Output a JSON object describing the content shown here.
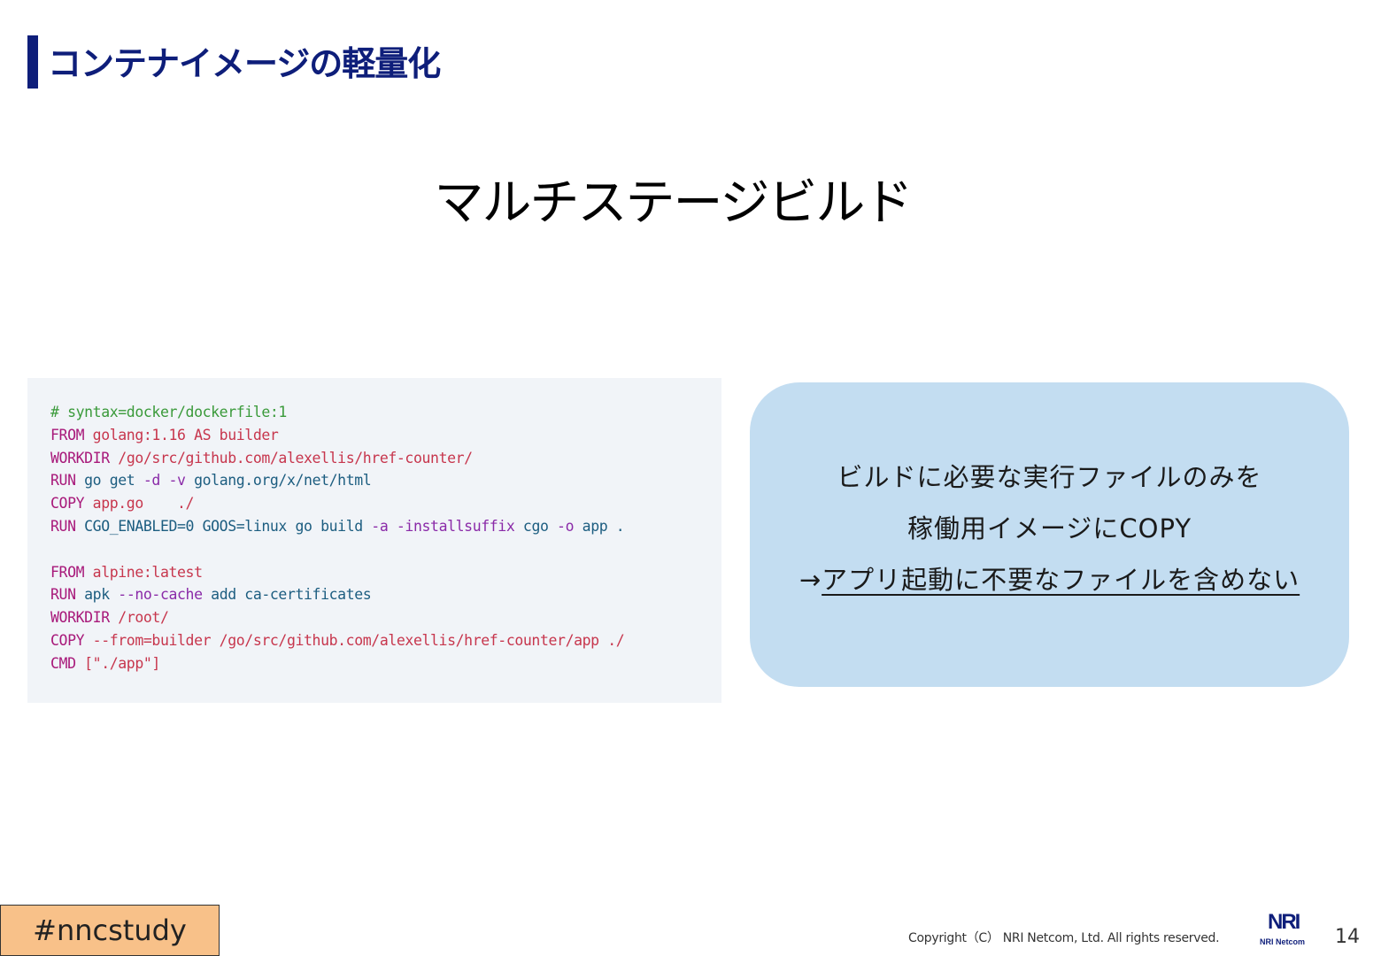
{
  "colors": {
    "title_navy": "#0e1e7a",
    "code_bg": "#f1f4f8",
    "callout_bg": "#c3ddf1",
    "hashtag_bg": "#f8c189",
    "code_comment": "#3a9a3a",
    "code_keyword": "#a8197a",
    "code_string": "#c7364d",
    "code_text": "#1c5d80",
    "code_flag": "#8a2aa8"
  },
  "header": {
    "title": "コンテナイメージの軽量化"
  },
  "main": {
    "subtitle": "マルチステージビルド",
    "code_lines": [
      [
        {
          "t": "# syntax=docker/dockerfile:1",
          "c": "comment"
        }
      ],
      [
        {
          "t": "FROM ",
          "c": "keyword"
        },
        {
          "t": "golang:1.16 AS builder",
          "c": "string"
        }
      ],
      [
        {
          "t": "WORKDIR ",
          "c": "keyword"
        },
        {
          "t": "/go/src/github.com/alexellis/href-counter/",
          "c": "string"
        }
      ],
      [
        {
          "t": "RUN ",
          "c": "keyword"
        },
        {
          "t": "go get ",
          "c": "text"
        },
        {
          "t": "-d -v ",
          "c": "flag"
        },
        {
          "t": "golang.org/x/net/html",
          "c": "text"
        }
      ],
      [
        {
          "t": "COPY ",
          "c": "keyword"
        },
        {
          "t": "app.go    ./",
          "c": "string"
        }
      ],
      [
        {
          "t": "RUN ",
          "c": "keyword"
        },
        {
          "t": "CGO_ENABLED=0 GOOS=linux go build ",
          "c": "text"
        },
        {
          "t": "-a -installsuffix ",
          "c": "flag"
        },
        {
          "t": "cgo ",
          "c": "text"
        },
        {
          "t": "-o ",
          "c": "flag"
        },
        {
          "t": "app .",
          "c": "text"
        }
      ],
      [
        {
          "t": "",
          "c": "text"
        }
      ],
      [
        {
          "t": "FROM ",
          "c": "keyword"
        },
        {
          "t": "alpine:latest",
          "c": "string"
        }
      ],
      [
        {
          "t": "RUN ",
          "c": "keyword"
        },
        {
          "t": "apk ",
          "c": "text"
        },
        {
          "t": "--no-cache ",
          "c": "flag"
        },
        {
          "t": "add ca-certificates",
          "c": "text"
        }
      ],
      [
        {
          "t": "WORKDIR ",
          "c": "keyword"
        },
        {
          "t": "/root/",
          "c": "string"
        }
      ],
      [
        {
          "t": "COPY ",
          "c": "keyword"
        },
        {
          "t": "--from=builder /go/src/github.com/alexellis/href-counter/app ./",
          "c": "string"
        }
      ],
      [
        {
          "t": "CMD ",
          "c": "keyword"
        },
        {
          "t": "[\"./app\"]",
          "c": "string"
        }
      ]
    ],
    "callout": {
      "line1": "ビルドに必要な実行ファイルのみを",
      "line2": "稼働用イメージにCOPY",
      "line3_arrow": "→",
      "line3_text": "アプリ起動に不要なファイルを含めない"
    }
  },
  "footer": {
    "hashtag": "#nncstudy",
    "copyright": "Copyright（C） NRI Netcom, Ltd. All rights reserved.",
    "logo_mark": "NRI",
    "logo_text": "NRI Netcom",
    "page_number": "14"
  }
}
